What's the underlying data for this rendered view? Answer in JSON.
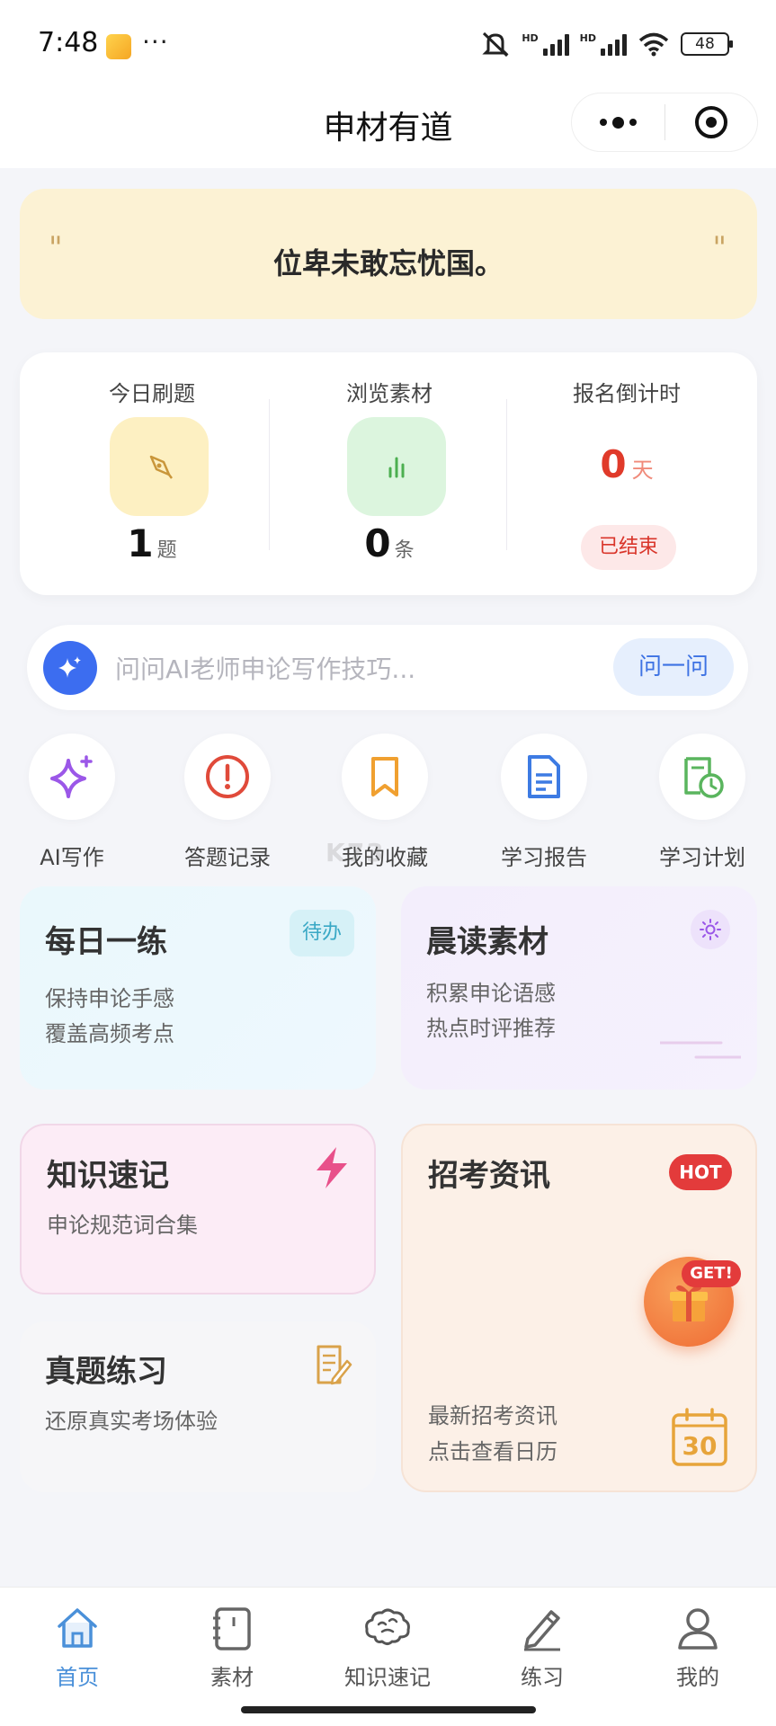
{
  "status_bar": {
    "time": "7:48",
    "more": "···",
    "battery": "48",
    "icons": [
      "app-notification-icon",
      "mute-icon",
      "signal-icon",
      "wifi-icon",
      "battery-icon"
    ]
  },
  "nav": {
    "title": "申材有道",
    "icons": [
      "more-icon",
      "target-icon"
    ]
  },
  "quote": {
    "open_mark": "\"",
    "text": "位卑未敢忘忧国。",
    "close_mark": "\""
  },
  "stats": {
    "today": {
      "label": "今日刷题",
      "value": "1",
      "unit": "题"
    },
    "browse": {
      "label": "浏览素材",
      "value": "0",
      "unit": "条"
    },
    "countdown": {
      "label": "报名倒计时",
      "value": "0",
      "unit": "天",
      "badge": "已结束"
    }
  },
  "ai": {
    "placeholder": "问问AI老师申论写作技巧...",
    "button": "问一问"
  },
  "shortcuts": [
    {
      "label": "AI写作",
      "icon": "sparkle-icon"
    },
    {
      "label": "答题记录",
      "icon": "alert-circle-icon"
    },
    {
      "label": "我的收藏",
      "icon": "bookmark-icon"
    },
    {
      "label": "学习报告",
      "icon": "document-icon"
    },
    {
      "label": "学习计划",
      "icon": "schedule-icon"
    }
  ],
  "watermark": "K73",
  "cards": {
    "daily": {
      "title": "每日一练",
      "badge": "待办",
      "line1": "保持申论手感",
      "line2": "覆盖高频考点"
    },
    "morning": {
      "title": "晨读素材",
      "line1": "积累申论语感",
      "line2": "热点时评推荐"
    },
    "knowledge": {
      "title": "知识速记",
      "line1": "申论规范词合集"
    },
    "exam_news": {
      "title": "招考资讯",
      "badge": "HOT",
      "line1": "最新招考资讯",
      "line2": "点击查看日历",
      "calendar_day": "30"
    },
    "real_exam": {
      "title": "真题练习",
      "line1": "还原真实考场体验"
    }
  },
  "gift": {
    "tag": "GET!"
  },
  "tabs": [
    {
      "label": "首页",
      "icon": "home-icon",
      "active": true
    },
    {
      "label": "素材",
      "icon": "notebook-icon",
      "active": false
    },
    {
      "label": "知识速记",
      "icon": "brain-icon",
      "active": false
    },
    {
      "label": "练习",
      "icon": "pencil-icon",
      "active": false
    },
    {
      "label": "我的",
      "icon": "user-icon",
      "active": false
    }
  ],
  "colors": {
    "accent_blue": "#4a90d9",
    "ai_blue": "#3c6df0",
    "danger_red": "#e03a2a",
    "quote_bg": "#fcf2d4"
  }
}
